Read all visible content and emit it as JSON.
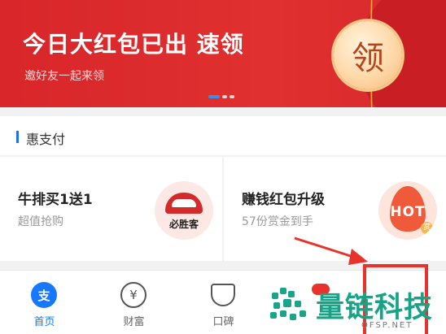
{
  "banner": {
    "title": "今日大红包已出 速领",
    "subtitle": "邀好友一起来领",
    "coin_label": "领",
    "page_count": 3,
    "active_page": 1
  },
  "section": {
    "title": "惠支付"
  },
  "cards": [
    {
      "title": "牛排买1送1",
      "subtitle": "超值抢购",
      "logo_text": "必胜客",
      "logo": "pizza-hut-logo"
    },
    {
      "title": "赚钱红包升级",
      "subtitle": "57份赏金到手",
      "logo_text": "HOT",
      "badge": "赏",
      "logo": "hot-flame-icon"
    }
  ],
  "tabbar": {
    "items": [
      {
        "label": "首页",
        "icon": "alipay-icon",
        "glyph": "支",
        "active": true
      },
      {
        "label": "财富",
        "icon": "yen-icon",
        "glyph": "¥",
        "active": false
      },
      {
        "label": "口碑",
        "icon": "koubei-icon",
        "glyph": "",
        "active": false
      }
    ]
  },
  "watermark": {
    "title": "量链科技",
    "url": "QFSP.NET"
  },
  "colors": {
    "banner_red": "#d8262a",
    "accent_blue": "#1677ff",
    "annotation_red": "#e8322c",
    "watermark_green": "#18a386"
  }
}
